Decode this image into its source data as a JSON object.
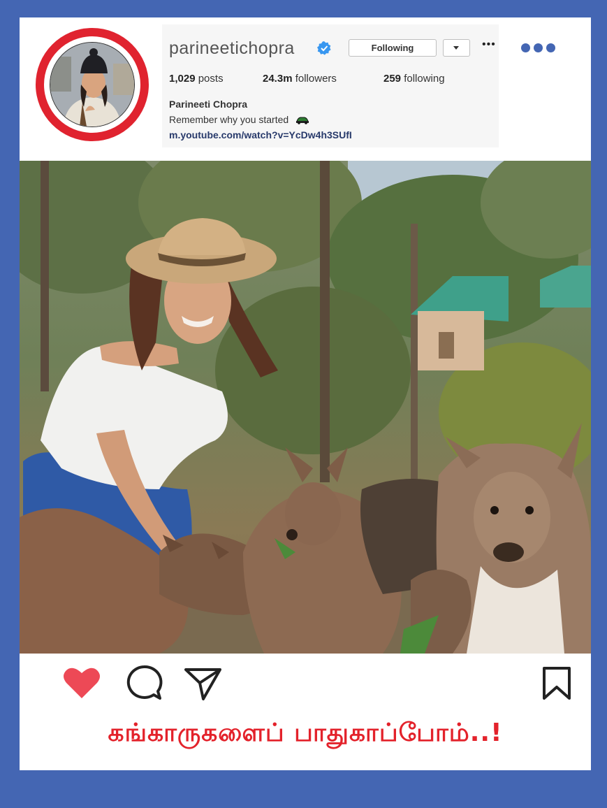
{
  "profile": {
    "username": "parineetichopra",
    "follow_label": "Following",
    "posts_count": "1,029",
    "posts_label": "posts",
    "followers_count": "24.3m",
    "followers_label": "followers",
    "following_count": "259",
    "following_label": "following",
    "full_name": "Parineeti Chopra",
    "bio": "Remember why you started",
    "link": "m.youtube.com/watch?v=YcDw4h3SUfI"
  },
  "icons": {
    "verified": "verified-badge-icon",
    "more": "more-dots-icon",
    "like": "heart-icon",
    "comment": "comment-icon",
    "share": "send-icon",
    "save": "bookmark-icon"
  },
  "caption": "கங்காருகளைப் பாதுகாப்போம்..!",
  "colors": {
    "frame": "#4466b3",
    "ring": "#e0232f",
    "heart": "#ed4956",
    "caption": "#e3222b",
    "verified": "#3897f0"
  }
}
